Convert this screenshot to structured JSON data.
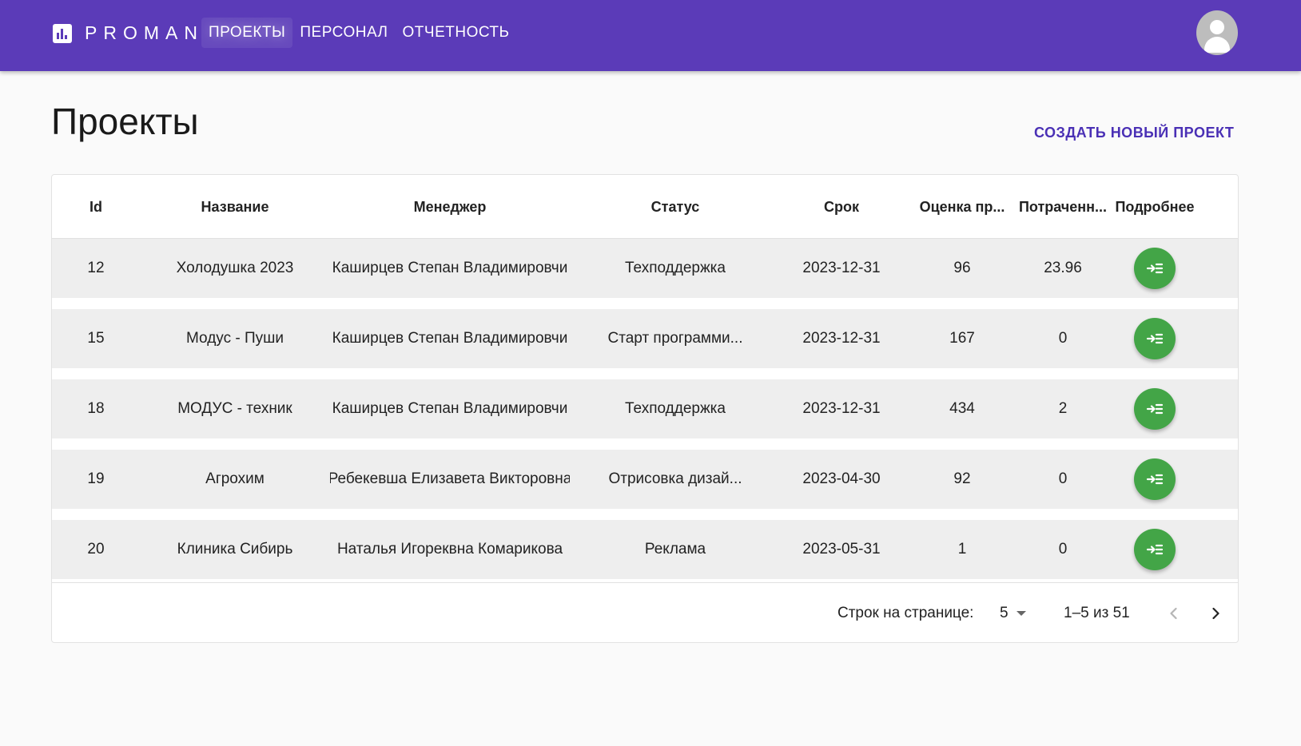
{
  "app": {
    "logo_text": "PROMAN",
    "nav": [
      {
        "label": "ПРОЕКТЫ",
        "active": true
      },
      {
        "label": "ПЕРСОНАЛ",
        "active": false
      },
      {
        "label": "ОТЧЕТНОСТЬ",
        "active": false
      }
    ],
    "colors": {
      "appbar": "#5b3bb8",
      "accent": "#4a30b5",
      "action_green": "#43a547",
      "row_bg": "#eeeeee"
    }
  },
  "page": {
    "title": "Проекты",
    "create_button": "СОЗДАТЬ НОВЫЙ ПРОЕКТ"
  },
  "table": {
    "columns": [
      "Id",
      "Название",
      "Менеджер",
      "Статус",
      "Срок",
      "Оценка пр...",
      "Потраченн...",
      "Подробнее"
    ],
    "rows": [
      {
        "id": "12",
        "name": "Холодушка 2023",
        "manager": "Каширцев Степан Владимировчи",
        "status": "Техподдержка",
        "deadline": "2023-12-31",
        "estimate": "96",
        "spent": "23.96"
      },
      {
        "id": "15",
        "name": "Модус - Пуши",
        "manager": "Каширцев Степан Владимировчи",
        "status": "Старт программи...",
        "deadline": "2023-12-31",
        "estimate": "167",
        "spent": "0"
      },
      {
        "id": "18",
        "name": "МОДУС - техник",
        "manager": "Каширцев Степан Владимировчи",
        "status": "Техподдержка",
        "deadline": "2023-12-31",
        "estimate": "434",
        "spent": "2"
      },
      {
        "id": "19",
        "name": "Агрохим",
        "manager": "Ребекевша Елизавета Викторовна",
        "status": "Отрисовка дизай...",
        "deadline": "2023-04-30",
        "estimate": "92",
        "spent": "0"
      },
      {
        "id": "20",
        "name": "Клиника Сибирь",
        "manager": "Наталья Игореквна Комарикова",
        "status": "Реклама",
        "deadline": "2023-05-31",
        "estimate": "1",
        "spent": "0"
      }
    ],
    "detail_icon": "enter-list-icon"
  },
  "pagination": {
    "rows_per_page_label": "Строк на странице:",
    "rows_per_page_value": "5",
    "range_text": "1–5 из 51"
  }
}
